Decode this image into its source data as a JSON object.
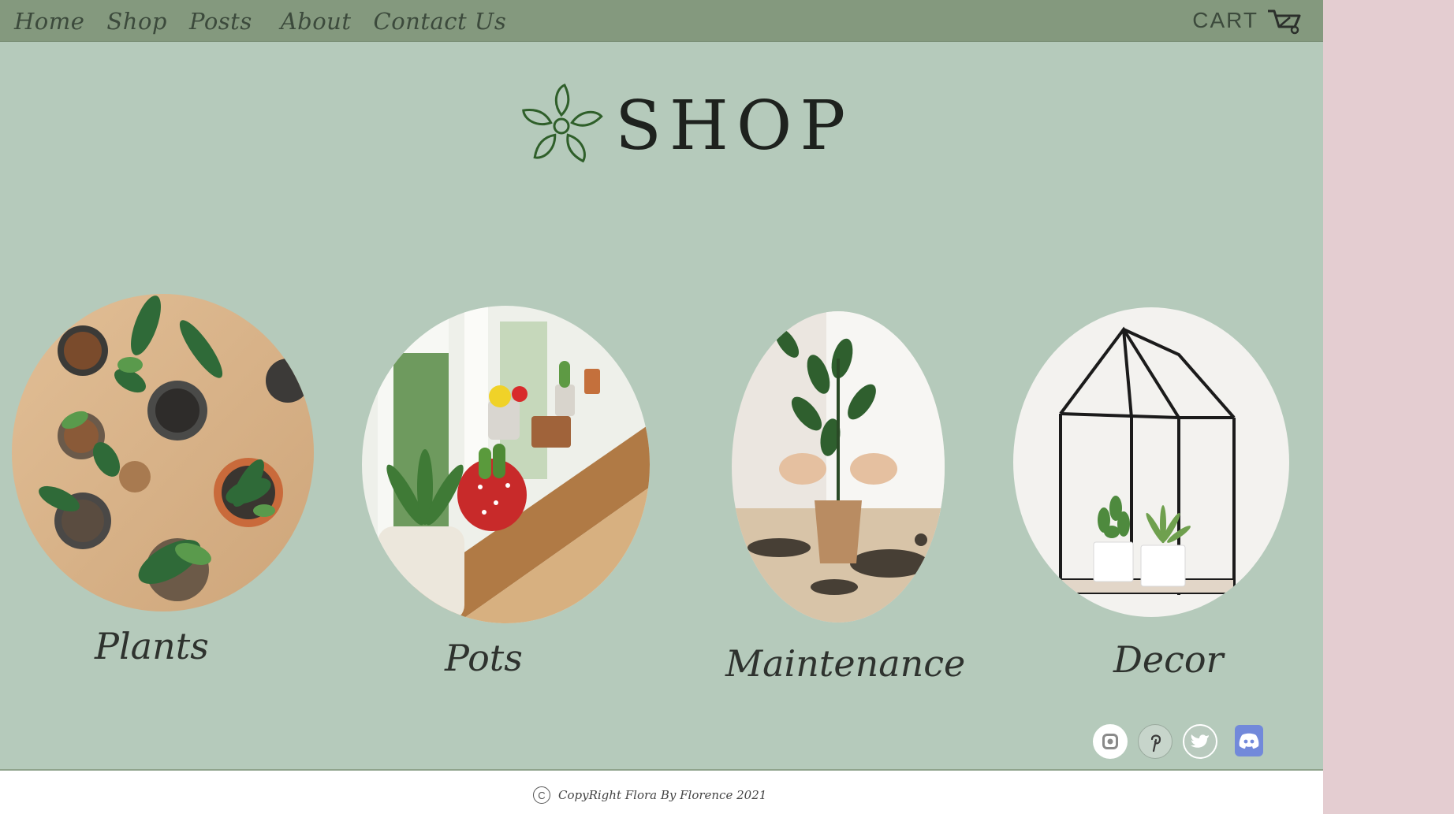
{
  "nav": {
    "links": [
      "Home",
      "Shop",
      "Posts",
      "About",
      "Contact Us"
    ],
    "cart_label": "CART",
    "cart_icon": "cart-icon"
  },
  "hero": {
    "title": "SHOP",
    "logo_icon": "flower-logo-icon"
  },
  "categories": [
    {
      "label": "Plants",
      "image": "potted-plants-photo"
    },
    {
      "label": "Pots",
      "image": "windowsill-pots-photo"
    },
    {
      "label": "Maintenance",
      "image": "repotting-photo"
    },
    {
      "label": "Decor",
      "image": "terrarium-house-photo"
    }
  ],
  "social": [
    "instagram-icon",
    "pinterest-icon",
    "twitter-icon",
    "discord-icon"
  ],
  "footer": {
    "copyright": "CopyRight Flora By Florence 2021"
  },
  "colors": {
    "nav_bg": "#84997e",
    "page_bg": "#b5cabb",
    "side_bg": "#e4cdd1",
    "footer_bg": "#ffffff",
    "discord": "#7289da"
  }
}
